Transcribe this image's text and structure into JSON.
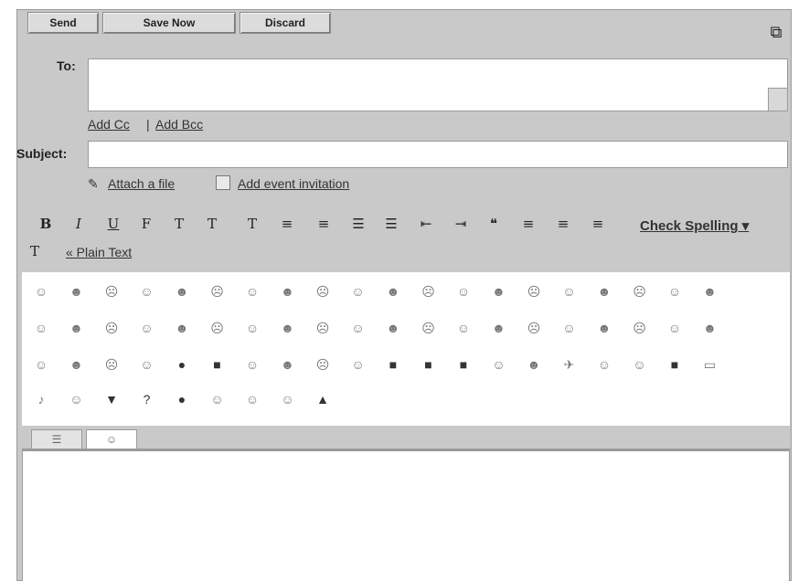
{
  "toolbar": {
    "send_label": "Send",
    "save_now_label": "Save Now",
    "discard_label": "Discard"
  },
  "fields": {
    "to_label": "To:",
    "to_value": "",
    "add_cc_label": "Add Cc",
    "separator": "|",
    "add_bcc_label": "Add Bcc",
    "subject_label": "Subject:",
    "subject_value": "",
    "attach_label": "Attach a file",
    "invite_label": "Add event invitation"
  },
  "formatting": {
    "buttons": [
      {
        "name": "bold-icon",
        "glyph": "B"
      },
      {
        "name": "italic-icon",
        "glyph": "I"
      },
      {
        "name": "underline-icon",
        "glyph": "U"
      },
      {
        "name": "font-icon",
        "glyph": "F"
      },
      {
        "name": "font-size-icon",
        "glyph": "T"
      },
      {
        "name": "text-color-icon",
        "glyph": "T"
      },
      {
        "name": "highlight-icon",
        "glyph": "T"
      },
      {
        "name": "link-icon",
        "glyph": "≡"
      },
      {
        "name": "unlink-icon",
        "glyph": "≡"
      },
      {
        "name": "numbered-list-icon",
        "glyph": "☰"
      },
      {
        "name": "bulleted-list-icon",
        "glyph": "☰"
      },
      {
        "name": "indent-less-icon",
        "glyph": "⇤"
      },
      {
        "name": "indent-more-icon",
        "glyph": "⇥"
      },
      {
        "name": "quote-icon",
        "glyph": "❝"
      },
      {
        "name": "align-left-icon",
        "glyph": "≡"
      },
      {
        "name": "align-center-icon",
        "glyph": "≡"
      },
      {
        "name": "align-right-icon",
        "glyph": "≡"
      }
    ],
    "check_spelling_label": "Check Spelling ▾",
    "plain_text_label": "« Plain Text"
  },
  "emoji_rows": [
    [
      "☺",
      "☻",
      "☹",
      "☺",
      "☻",
      "☹",
      "☺",
      "☻",
      "☹",
      "☺",
      "☻",
      "☹",
      "☺",
      "☻",
      "☹",
      "☺",
      "☻",
      "☹",
      "☺",
      "☻"
    ],
    [
      "☺",
      "☻",
      "☹",
      "☺",
      "☻",
      "☹",
      "☺",
      "☻",
      "☹",
      "☺",
      "☻",
      "☹",
      "☺",
      "☻",
      "☹",
      "☺",
      "☻",
      "☹",
      "☺",
      "☻"
    ],
    [
      "☺",
      "☻",
      "☹",
      "☺",
      "●",
      "■",
      "☺",
      "☻",
      "☹",
      "☺",
      "■",
      "■",
      "■",
      "☺",
      "☻",
      "✈",
      "☺",
      "☺",
      "■",
      "▭"
    ],
    [
      "♪",
      "☺",
      "▼",
      "?",
      "●",
      "☺",
      "☺",
      "☺",
      "▲"
    ]
  ],
  "colors": {
    "frame_bg": "#c9c9c9",
    "button_bg": "#dcdcdc",
    "input_bg": "#ffffff"
  }
}
